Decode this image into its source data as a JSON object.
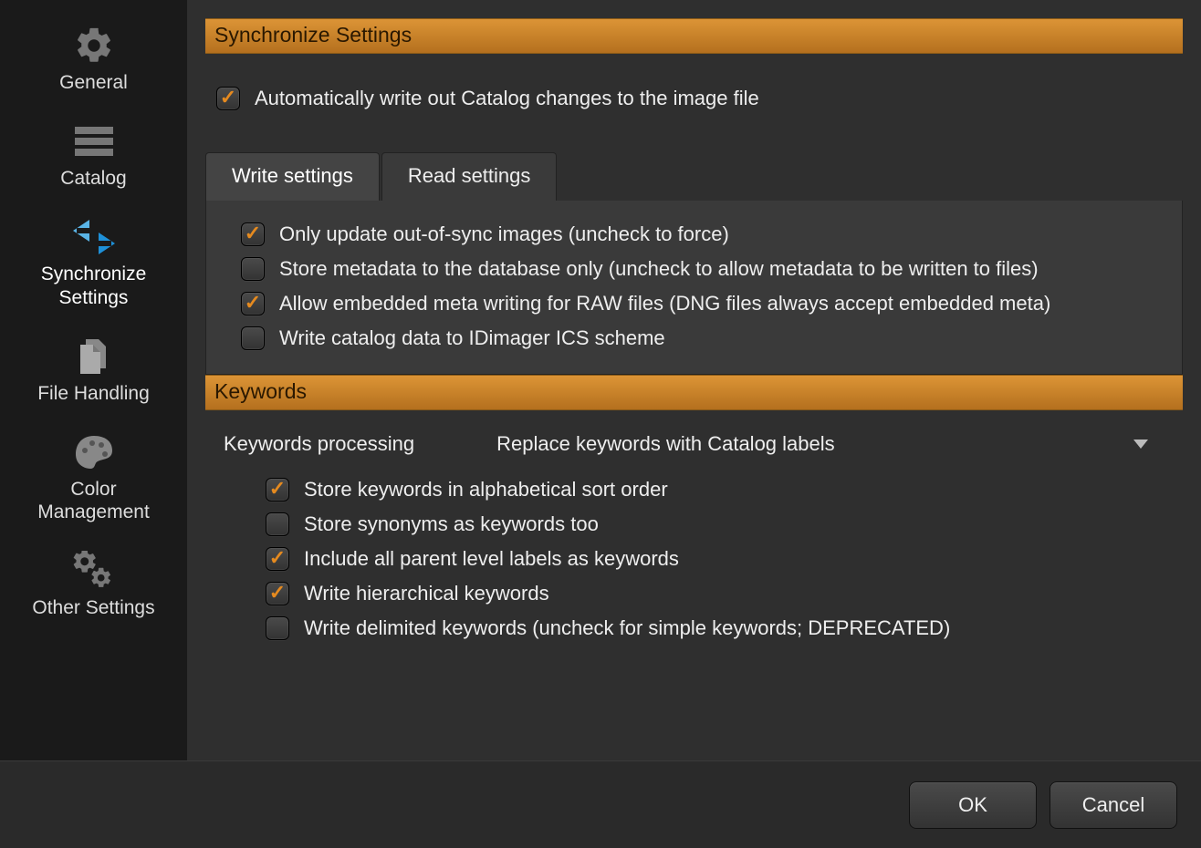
{
  "sidebar": {
    "items": [
      {
        "label": "General",
        "label2": ""
      },
      {
        "label": "Catalog",
        "label2": ""
      },
      {
        "label": "Synchronize",
        "label2": "Settings"
      },
      {
        "label": "File Handling",
        "label2": ""
      },
      {
        "label": "Color",
        "label2": "Management"
      },
      {
        "label": "Other Settings",
        "label2": ""
      }
    ]
  },
  "sections": {
    "sync_header": "Synchronize Settings",
    "keywords_header": "Keywords"
  },
  "top_option": {
    "auto_write_label": "Automatically write out Catalog changes to the image file"
  },
  "tabs": {
    "items": [
      {
        "label": "Write settings"
      },
      {
        "label": "Read settings"
      }
    ]
  },
  "write_settings": {
    "opt1": "Only update out-of-sync images (uncheck to force)",
    "opt2": "Store metadata to the database only (uncheck to allow metadata to be written to files)",
    "opt3": "Allow embedded meta writing for RAW files (DNG files always accept embedded meta)",
    "opt4": "Write catalog data to IDimager ICS scheme"
  },
  "keywords": {
    "processing_label": "Keywords processing",
    "select_value": "Replace keywords with Catalog labels",
    "opt1": "Store keywords in alphabetical sort order",
    "opt2": "Store synonyms as keywords too",
    "opt3": "Include all parent level labels as keywords",
    "opt4": "Write hierarchical keywords",
    "opt5": "Write delimited keywords (uncheck for simple keywords; DEPRECATED)"
  },
  "footer": {
    "ok": "OK",
    "cancel": "Cancel"
  }
}
